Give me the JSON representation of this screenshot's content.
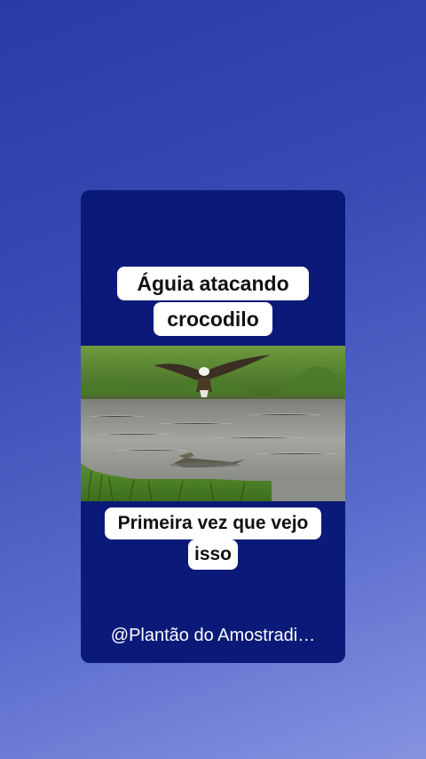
{
  "post": {
    "title_line_1": "Águia atacando",
    "title_line_2": "crocodilo",
    "caption_line_1": "Primeira vez que vejo",
    "caption_line_2": "isso",
    "watermark": "@Plantão do Amostradi…"
  },
  "colors": {
    "card_background": "#0b1a78",
    "bubble_background": "#ffffff",
    "page_gradient_start": "#2a3aa6",
    "page_gradient_end": "#8593e0"
  },
  "media": {
    "scene_icon": "eagle-crocodile-video"
  }
}
